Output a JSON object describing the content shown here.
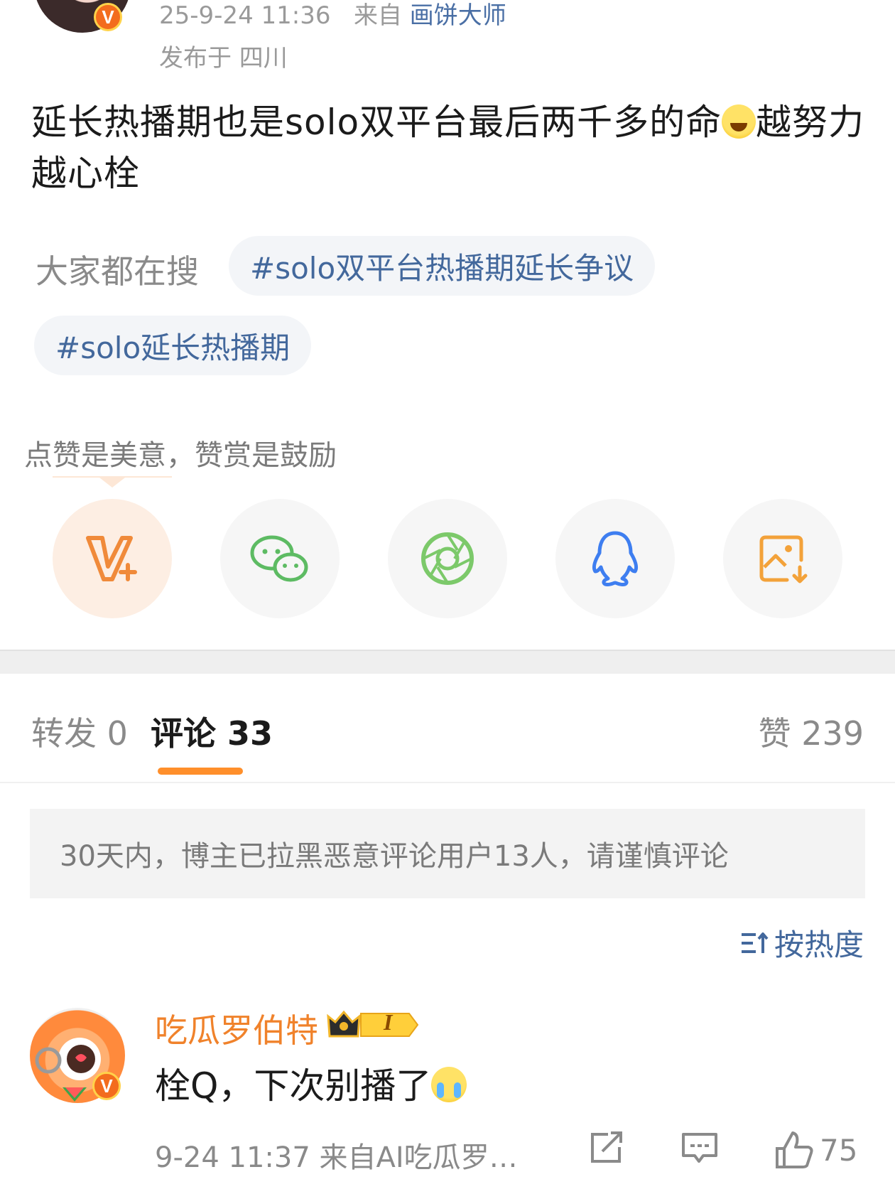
{
  "post": {
    "timestamp": "25-9-24 11:36",
    "source_prefix": "来自",
    "source": "画饼大师",
    "location": "发布于 四川",
    "text_part1": "延长热播期也是solo双平台最后两千多的命",
    "text_part2": "越努力越心栓",
    "verified_badge": "V"
  },
  "search": {
    "label": "大家都在搜",
    "tags": [
      "#solo双平台热播期延长争议",
      "#solo延长热播期"
    ]
  },
  "share": {
    "encourage_text": "点赞是美意，赞赏是鼓励",
    "buttons": [
      "vip-plus-icon",
      "wechat-icon",
      "moments-icon",
      "qq-icon",
      "save-image-icon"
    ]
  },
  "tabs": {
    "repost": "转发 0",
    "comments": "评论 33",
    "likes": "赞 239"
  },
  "notice": "30天内，博主已拉黑恶意评论用户13人，请谨慎评论",
  "sort_label": "按热度",
  "comment": {
    "author": "吃瓜罗伯特",
    "level_badge": "I",
    "text": "栓Q，下次别播了",
    "meta": "9-24 11:37  来自AI吃瓜罗…",
    "like_count": "75"
  },
  "colors": {
    "accent_orange": "#ff8f2b",
    "link_blue": "#43689c",
    "wechat_green": "#5dbb63",
    "qq_blue": "#3e7ef0"
  }
}
